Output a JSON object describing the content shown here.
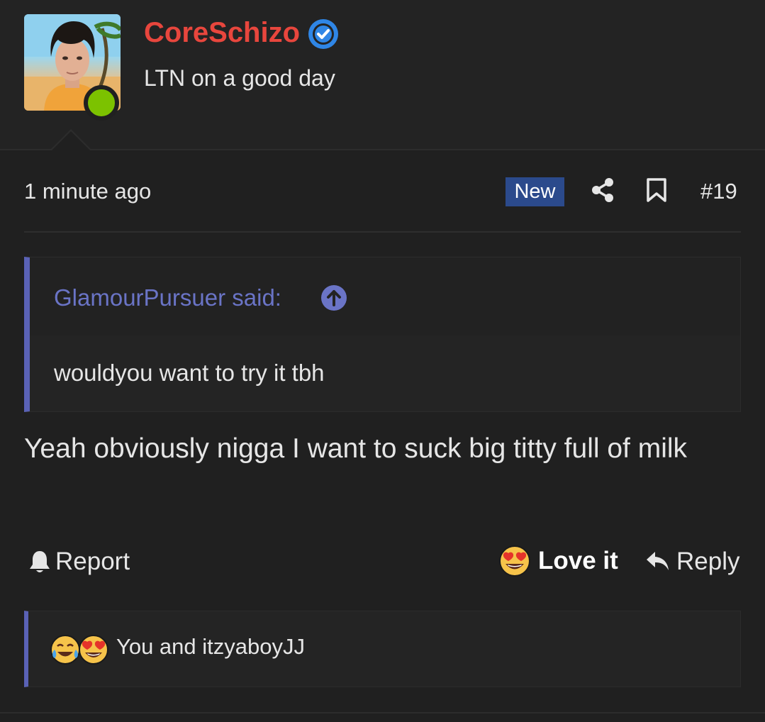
{
  "author": {
    "username": "CoreSchizo",
    "title": "LTN on a good day",
    "verified_icon": "verified-check-icon",
    "avatar_icon": "user-avatar",
    "status_color": "#7cc200",
    "username_color": "#e8463d"
  },
  "post": {
    "time": "1 minute ago",
    "badge": "New",
    "number": "#19",
    "share_icon": "share-icon",
    "bookmark_icon": "bookmark-icon"
  },
  "quote": {
    "author_line": "GlamourPursuer said:",
    "text": "wouldyou want to try it tbh",
    "accent_color": "#5a62b6"
  },
  "message": {
    "text": "Yeah obviously nigga I want to suck big titty full of milk"
  },
  "actions": {
    "report": "Report",
    "love": "Love it",
    "reply": "Reply"
  },
  "reactions": {
    "icons": [
      "tears-of-joy-emoji",
      "heart-eyes-emoji"
    ],
    "summary": "You and itzyaboyJJ"
  }
}
